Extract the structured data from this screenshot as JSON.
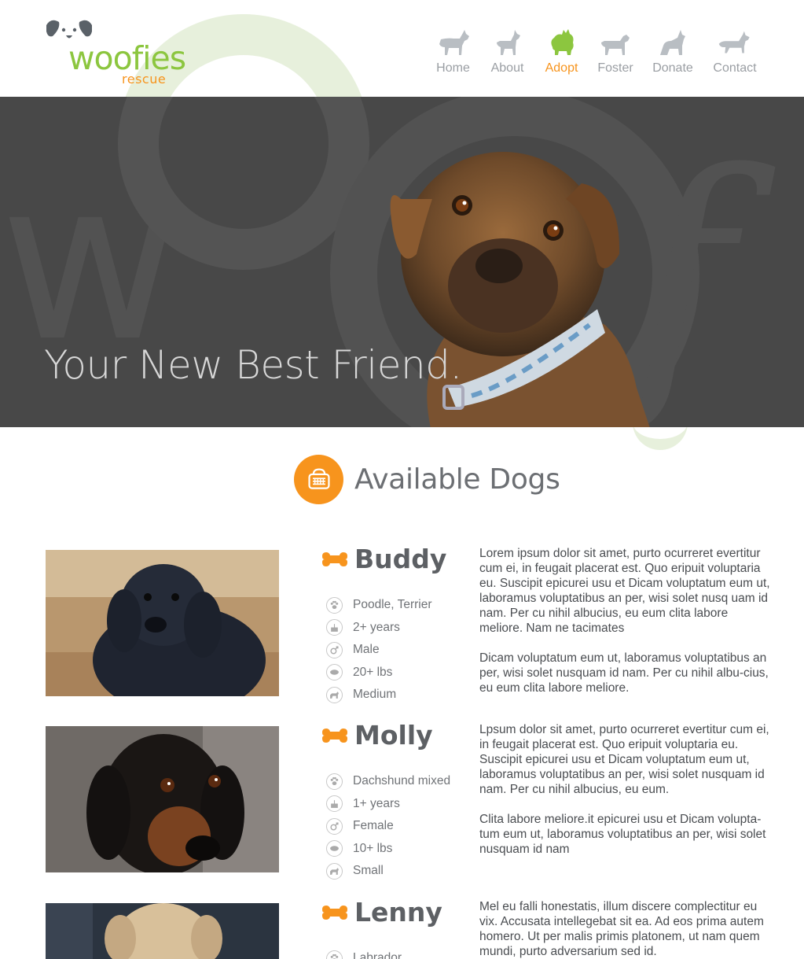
{
  "brand": {
    "name": "woofies",
    "subtitle": "rescue",
    "colors": {
      "green": "#8cc63f",
      "orange": "#f7941d",
      "hero_bg": "#484848"
    }
  },
  "nav": {
    "items": [
      {
        "label": "Home",
        "icon": "dog-silhouette-icon",
        "active": false
      },
      {
        "label": "About",
        "icon": "dog-silhouette-icon",
        "active": false
      },
      {
        "label": "Adopt",
        "icon": "dog-silhouette-icon",
        "active": true
      },
      {
        "label": "Foster",
        "icon": "dog-silhouette-icon",
        "active": false
      },
      {
        "label": "Donate",
        "icon": "dog-silhouette-icon",
        "active": false
      },
      {
        "label": "Contact",
        "icon": "dog-silhouette-icon",
        "active": false
      }
    ]
  },
  "hero": {
    "title": "Your New Best Friend."
  },
  "section": {
    "title": "Available Dogs",
    "icon": "pet-carrier-icon"
  },
  "dogs": [
    {
      "name": "Buddy",
      "traits": [
        "Poodle, Terrier",
        "2+ years",
        "Male",
        "20+ lbs",
        "Medium"
      ],
      "description": [
        "Lorem ipsum dolor sit amet, purto ocurreret evertitur cum ei, in feugait placerat est. Quo eripuit voluptaria eu. Suscipit epicurei usu et Dicam voluptatum eum ut, laboramus voluptatibus an per, wisi solet nusq uam id nam. Per cu nihil albucius, eu eum clita labore meliore. Nam ne tacimates",
        "Dicam voluptatum eum ut, laboramus voluptatibus an per, wisi solet nusquam id nam. Per cu nihil albu-cius, eu eum clita labore meliore."
      ]
    },
    {
      "name": "Molly",
      "traits": [
        "Dachshund mixed",
        "1+ years",
        "Female",
        "10+ lbs",
        "Small"
      ],
      "description": [
        "Lpsum dolor sit amet, purto ocurreret evertitur cum ei, in feugait placerat est. Quo eripuit voluptaria eu. Suscipit epicurei usu et Dicam voluptatum eum ut, laboramus voluptatibus an per, wisi solet nusquam id nam. Per cu nihil albucius, eu eum.",
        "Clita labore meliore.it epicurei usu et Dicam volupta-tum eum ut, laboramus voluptatibus an per, wisi solet nusquam id nam"
      ]
    },
    {
      "name": "Lenny",
      "traits": [
        "Labrador"
      ],
      "description": [
        "Mel eu falli honestatis, illum discere complectitur eu vix. Accusata intellegebat sit ea. Ad eos prima autem homero. Ut per malis primis platonem, ut nam quem mundi, purto adversarium sed id."
      ]
    }
  ],
  "trait_icons": [
    "paw-icon",
    "cake-icon",
    "gender-icon",
    "weight-icon",
    "size-icon"
  ]
}
